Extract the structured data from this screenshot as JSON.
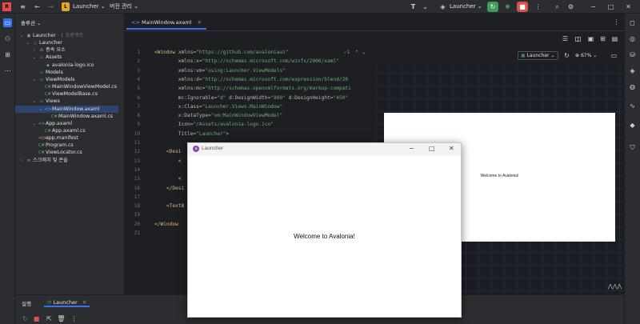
{
  "titlebar": {
    "project_badge": "L",
    "project_name": "Launcher",
    "vcs_label": "버전 관리",
    "run_config": "Launcher"
  },
  "project_panel": {
    "title": "솔루션",
    "tree": [
      {
        "label": "Launcher",
        "suffix": "· 1 프로젝트",
        "depth": 0,
        "icon": "solution-icon",
        "expanded": true
      },
      {
        "label": "Launcher",
        "depth": 1,
        "icon": "project-icon",
        "expanded": true
      },
      {
        "label": "종속 요소",
        "depth": 2,
        "icon": "dependencies-icon",
        "expanded": false
      },
      {
        "label": "Assets",
        "depth": 2,
        "icon": "folder-icon",
        "expanded": true
      },
      {
        "label": "avalonia-logo.ico",
        "depth": 3,
        "icon": "image-file-icon"
      },
      {
        "label": "Models",
        "depth": 2,
        "icon": "folder-icon"
      },
      {
        "label": "ViewModels",
        "depth": 2,
        "icon": "folder-icon",
        "expanded": true
      },
      {
        "label": "MainWindowViewModel.cs",
        "depth": 3,
        "icon": "csharp-file-icon"
      },
      {
        "label": "ViewModelBase.cs",
        "depth": 3,
        "icon": "csharp-file-icon"
      },
      {
        "label": "Views",
        "depth": 2,
        "icon": "folder-icon",
        "expanded": true
      },
      {
        "label": "MainWindow.axaml",
        "depth": 3,
        "icon": "axaml-file-icon",
        "expanded": true,
        "selected": true
      },
      {
        "label": "MainWindow.axaml.cs",
        "depth": 4,
        "icon": "csharp-file-icon"
      },
      {
        "label": "App.axaml",
        "depth": 2,
        "icon": "axaml-file-icon",
        "expanded": true
      },
      {
        "label": "App.axaml.cs",
        "depth": 3,
        "icon": "csharp-file-icon"
      },
      {
        "label": "app.manifest",
        "depth": 2,
        "icon": "xml-file-icon"
      },
      {
        "label": "Program.cs",
        "depth": 2,
        "icon": "csharp-file-icon"
      },
      {
        "label": "ViewLocator.cs",
        "depth": 2,
        "icon": "csharp-file-icon"
      },
      {
        "label": "스크래치 및 콘솔",
        "depth": 0,
        "icon": "scratches-icon",
        "expanded": false
      }
    ]
  },
  "editor": {
    "tab_label": "MainWindow.axaml",
    "inspection_count": "1",
    "line_numbers": [
      "1",
      "2",
      "3",
      "4",
      "5",
      "6",
      "7",
      "8",
      "9",
      "10",
      "11",
      "12",
      "13",
      "14",
      "15",
      "16",
      "17",
      "18",
      "19",
      "20",
      "21"
    ],
    "lines": [
      {
        "n": "1",
        "parts": [
          [
            "tag",
            "<Window "
          ],
          [
            "attr",
            "xmlns="
          ],
          [
            "val",
            "\"https://github.com/avaloniaui\""
          ]
        ]
      },
      {
        "n": "2",
        "parts": [
          [
            "attr",
            "        xmlns:x="
          ],
          [
            "val",
            "\"http://schemas.microsoft.com/winfx/2006/xaml\""
          ]
        ]
      },
      {
        "n": "3",
        "parts": [
          [
            "attr",
            "        xmlns:vm="
          ],
          [
            "val",
            "\"using:Launcher.ViewModels\""
          ]
        ]
      },
      {
        "n": "4",
        "parts": [
          [
            "attr",
            "        xmlns:d="
          ],
          [
            "val",
            "\"http://schemas.microsoft.com/expression/blend/20"
          ]
        ]
      },
      {
        "n": "5",
        "parts": [
          [
            "attr",
            "        xmlns:mc="
          ],
          [
            "val",
            "\"http://schemas.openxmlformats.org/markup-compati"
          ]
        ]
      },
      {
        "n": "6",
        "parts": [
          [
            "attr",
            "        mc:Ignorable="
          ],
          [
            "val",
            "\"d\" "
          ],
          [
            "attr",
            "d:DesignWidth="
          ],
          [
            "val",
            "\"800\" "
          ],
          [
            "attr",
            "d:DesignHeight="
          ],
          [
            "val",
            "\"450\""
          ]
        ]
      },
      {
        "n": "7",
        "parts": [
          [
            "attr",
            "        x:Class="
          ],
          [
            "val",
            "\"Launcher.Views.MainWindow\""
          ]
        ]
      },
      {
        "n": "8",
        "parts": [
          [
            "attr",
            "        x:DataType="
          ],
          [
            "val",
            "\"vm:MainWindowViewModel\""
          ]
        ]
      },
      {
        "n": "9",
        "parts": [
          [
            "attr",
            "        Icon="
          ],
          [
            "val",
            "\"/Assets/avalonia-logo.ico\""
          ]
        ]
      },
      {
        "n": "10",
        "parts": [
          [
            "attr",
            "        Title="
          ],
          [
            "val",
            "\"Launcher\""
          ],
          [
            "ns",
            ">"
          ]
        ]
      },
      {
        "n": "11",
        "parts": [
          [
            "ns",
            ""
          ]
        ]
      },
      {
        "n": "12",
        "parts": [
          [
            "tag",
            "    <Desi"
          ]
        ]
      },
      {
        "n": "13",
        "parts": [
          [
            "ns",
            "        <"
          ]
        ]
      },
      {
        "n": "14",
        "parts": [
          [
            "ns",
            "        "
          ]
        ]
      },
      {
        "n": "15",
        "parts": [
          [
            "ns",
            "        <"
          ]
        ]
      },
      {
        "n": "16",
        "parts": [
          [
            "tag",
            "    </Desi"
          ]
        ]
      },
      {
        "n": "17",
        "parts": [
          [
            "ns",
            ""
          ]
        ]
      },
      {
        "n": "18",
        "parts": [
          [
            "tag",
            "    <TextB"
          ]
        ]
      },
      {
        "n": "19",
        "parts": [
          [
            "ns",
            ""
          ]
        ]
      },
      {
        "n": "20",
        "parts": [
          [
            "tag",
            "</Window"
          ]
        ]
      },
      {
        "n": "21",
        "parts": [
          [
            "ns",
            ""
          ]
        ]
      }
    ]
  },
  "preview": {
    "run_config": "Launcher",
    "zoom": "67%",
    "design_text": "Welcome to Avalonia!"
  },
  "app_window": {
    "title": "Launcher",
    "content": "Welcome to Avalonia!"
  },
  "bottom_panel": {
    "tab_settings": "실행",
    "tab_launcher": "Launcher"
  },
  "colors": {
    "accent": "#3574f0",
    "run_green": "#3f9e5b",
    "stop_red": "#d9534f",
    "project_badge": "#e3a82a"
  }
}
